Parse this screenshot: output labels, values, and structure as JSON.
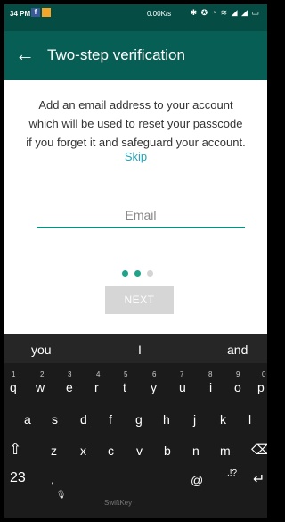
{
  "status_bar": {
    "time": "34 PM",
    "fb_letter": "f",
    "rate": "0.00K/s",
    "icons": "✱ ✪ ◔ ≋ ◢ ◢ ▭"
  },
  "app_bar": {
    "back_glyph": "←",
    "title": "Two-step verification"
  },
  "content": {
    "description_lines": [
      "Add an email address to your account",
      "which will be used to reset your passcode",
      "if you forget it and safeguard your account."
    ],
    "skip_label": "Skip",
    "email_placeholder": "Email",
    "email_value": "",
    "page_indicator": {
      "total": 3,
      "active": [
        1,
        2
      ]
    },
    "next_label": "NEXT"
  },
  "keyboard": {
    "suggestions": [
      "you",
      "I",
      "and"
    ],
    "numbers": [
      "1",
      "2",
      "3",
      "4",
      "5",
      "6",
      "7",
      "8",
      "9",
      "0"
    ],
    "row1": [
      "q",
      "w",
      "e",
      "r",
      "t",
      "y",
      "u",
      "i",
      "o",
      "p"
    ],
    "row2": [
      "a",
      "s",
      "d",
      "f",
      "g",
      "h",
      "j",
      "k",
      "l"
    ],
    "row3": [
      "z",
      "x",
      "c",
      "v",
      "b",
      "n",
      "m"
    ],
    "shift_glyph": "⇧",
    "backspace_glyph": "⌫",
    "symbols_label": "23",
    "comma_label": ",",
    "mic_glyph": "🎙",
    "brand_label": "SwiftKey",
    "at_label": "@",
    "punct_label": ".!?",
    "enter_glyph": "↵"
  }
}
